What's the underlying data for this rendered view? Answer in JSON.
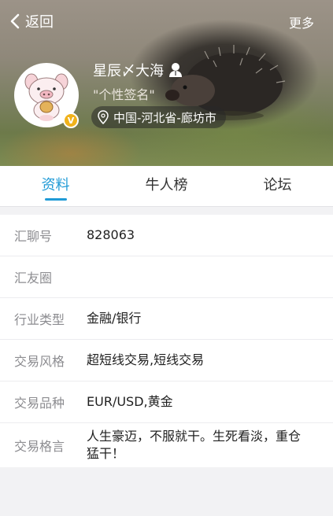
{
  "nav": {
    "back_label": "返回",
    "more_label": "更多"
  },
  "profile": {
    "username": "星辰〆大海",
    "signature": "\"个性签名\"",
    "location": "中国-河北省-廊坊市",
    "badge": "V"
  },
  "tabs": [
    {
      "label": "资料",
      "active": true
    },
    {
      "label": "牛人榜",
      "active": false
    },
    {
      "label": "论坛",
      "active": false
    }
  ],
  "info": [
    {
      "label": "汇聊号",
      "value": "828063"
    },
    {
      "label": "汇友圈",
      "value": ""
    },
    {
      "label": "行业类型",
      "value": "金融/银行"
    },
    {
      "label": "交易风格",
      "value": "超短线交易,短线交易"
    },
    {
      "label": "交易品种",
      "value": "EUR/USD,黄金"
    },
    {
      "label": "交易格言",
      "value": "人生豪迈，不服就干。生死看淡，重仓猛干！"
    }
  ],
  "colors": {
    "accent": "#1f9ad6",
    "badge": "#f0b21b"
  }
}
